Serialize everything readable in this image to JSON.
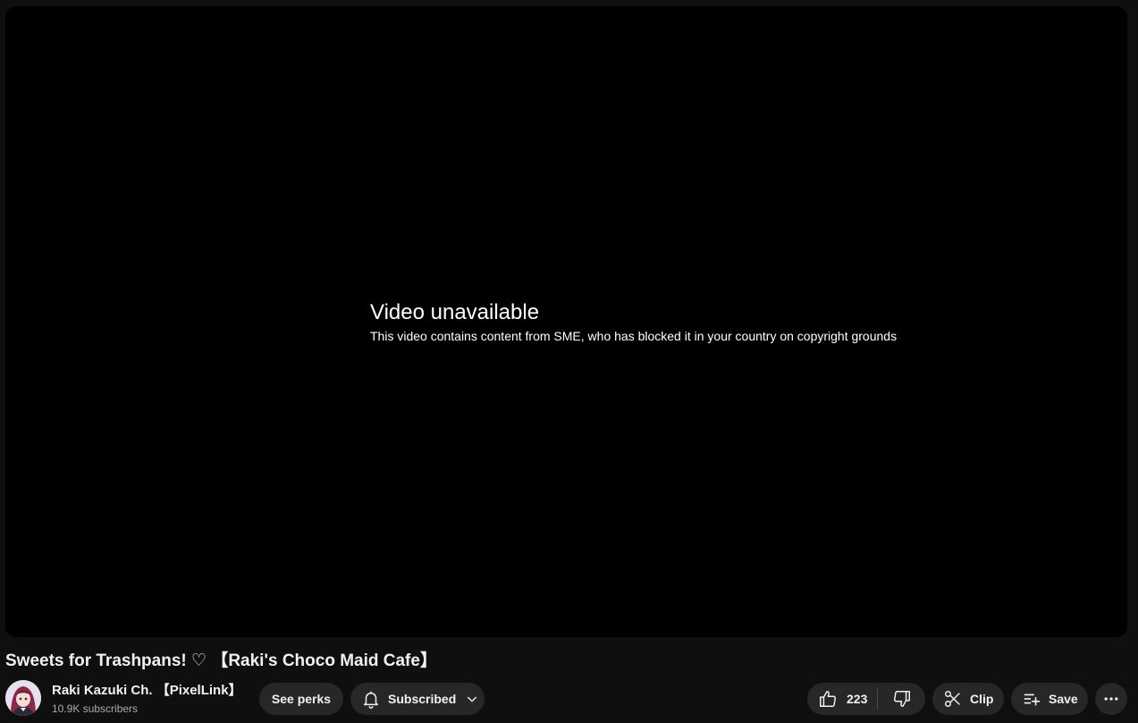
{
  "player": {
    "error_title": "Video unavailable",
    "error_reason": "This video contains content from SME, who has blocked it in your country on copyright grounds"
  },
  "video": {
    "title": "Sweets for Trashpans! ♡ 【Raki's Choco Maid Cafe】"
  },
  "channel": {
    "name": "Raki Kazuki Ch. 【PixelLink】",
    "subscribers": "10.9K subscribers",
    "avatar_icon": "channel-avatar"
  },
  "actions": {
    "see_perks_label": "See perks",
    "subscribed_label": "Subscribed",
    "like_count": "223",
    "clip_label": "Clip",
    "save_label": "Save"
  },
  "colors": {
    "background": "#0f0f0f",
    "player_background": "#000000",
    "button_background": "#272727",
    "secondary_text": "#aaaaaa"
  }
}
